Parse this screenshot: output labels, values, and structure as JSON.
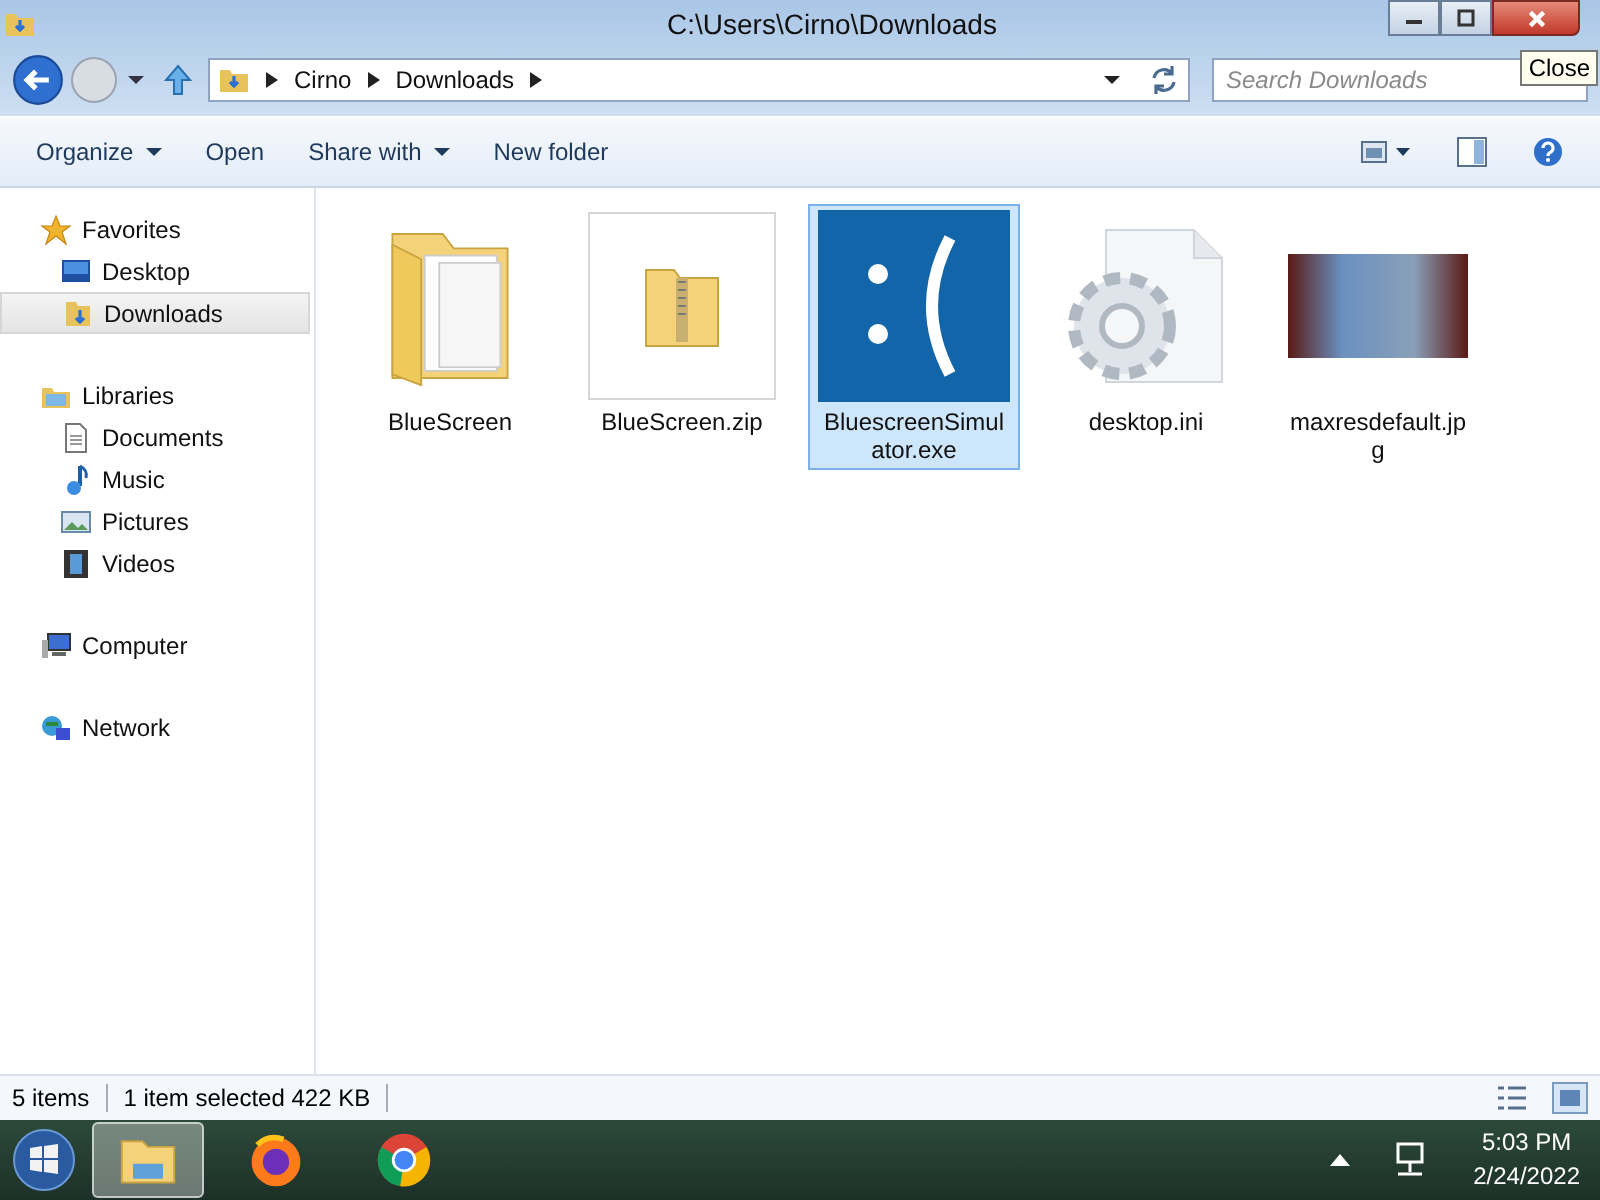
{
  "window": {
    "title": "C:\\Users\\Cirno\\Downloads",
    "close_tooltip": "Close"
  },
  "address_bar": {
    "crumbs": [
      "Cirno",
      "Downloads"
    ],
    "search_placeholder": "Search Downloads"
  },
  "toolbar": {
    "items": [
      {
        "label": "Organize",
        "dropdown": true
      },
      {
        "label": "Open",
        "dropdown": false
      },
      {
        "label": "Share with",
        "dropdown": true
      },
      {
        "label": "New folder",
        "dropdown": false
      }
    ]
  },
  "sidebar": {
    "items": [
      {
        "label": "Favorites",
        "kind": "star",
        "selected": false,
        "children": [
          {
            "label": "Desktop",
            "kind": "desktop",
            "selected": false
          },
          {
            "label": "Downloads",
            "kind": "downloads",
            "selected": true
          }
        ]
      },
      {
        "label": "Libraries",
        "kind": "library",
        "selected": false,
        "children": [
          {
            "label": "Documents",
            "kind": "document",
            "selected": false
          },
          {
            "label": "Music",
            "kind": "music",
            "selected": false
          },
          {
            "label": "Pictures",
            "kind": "pictures",
            "selected": false
          },
          {
            "label": "Videos",
            "kind": "videos",
            "selected": false
          }
        ]
      },
      {
        "label": "Computer",
        "kind": "computer",
        "selected": false
      },
      {
        "label": "Network",
        "kind": "network",
        "selected": false
      }
    ]
  },
  "files": [
    {
      "name": "BlueScreen",
      "kind": "folder",
      "selected": false
    },
    {
      "name": "BlueScreen.zip",
      "kind": "zip",
      "selected": false
    },
    {
      "name": "BluescreenSimulator.exe",
      "kind": "bluescreen",
      "selected": true
    },
    {
      "name": "desktop.ini",
      "kind": "settings",
      "selected": false
    },
    {
      "name": "maxresdefault.jpg",
      "kind": "photo",
      "selected": false
    }
  ],
  "status_bar": {
    "count": "5 items",
    "selection": "1 item selected  422 KB"
  },
  "taskbar": {
    "apps": [
      {
        "kind": "explorer",
        "selected": true
      },
      {
        "kind": "firefox",
        "selected": false
      },
      {
        "kind": "chrome",
        "selected": false
      }
    ],
    "time": "5:03 PM",
    "date": "2/24/2022"
  }
}
